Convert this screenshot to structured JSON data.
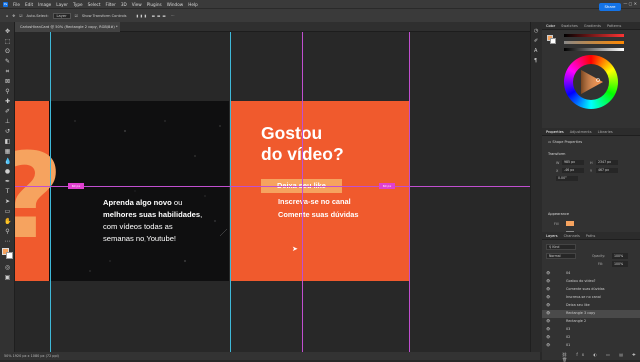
{
  "menubar": {
    "logo": "Ps",
    "items": [
      "File",
      "Edit",
      "Image",
      "Layer",
      "Type",
      "Select",
      "Filter",
      "3D",
      "View",
      "Plugins",
      "Window",
      "Help"
    ]
  },
  "optionsbar": {
    "auto_select": "Auto-Select:",
    "auto_select_value": "Layer",
    "show_transform": "Show Transform Controls",
    "share": "Share"
  },
  "doc_tab": {
    "title": "CarlosHiranCard @ 50% (Rectangle 2 copy, RGB/8#) *"
  },
  "status": {
    "text": "50%      1920 px x 1080 px (72 ppi)"
  },
  "artwork": {
    "left_text_bold1": "Aprenda algo novo",
    "left_text_1": " ou",
    "left_text_bold2": "melhores suas habilidades",
    "left_text_2": ",",
    "left_text_3": "com vídeos todas as",
    "left_text_4": "semanas no Youtube!",
    "title_line1": "Gostou",
    "title_line2": "do vídeo?",
    "btn_like": "Deixa seu like",
    "subscribe": "Inscreva-se no canal",
    "comment": "Comente suas dúvidas",
    "guide_label_left": "60 px",
    "guide_label_right": "60 px",
    "colors": {
      "orange": "#f05a2d",
      "light_orange": "#f6a35f",
      "dark": "#0f0f10"
    }
  },
  "panels": {
    "color_tabs": [
      "Color",
      "Swatches",
      "Gradients",
      "Patterns"
    ],
    "properties_tabs": [
      "Properties",
      "Adjustments",
      "Libraries"
    ],
    "properties_type": "Shape Properties",
    "transform_label": "Transform",
    "w_label": "W",
    "w_value": "985 px",
    "h_label": "H",
    "h_value": "2347 px",
    "x_label": "X",
    "x_value": "-46 px",
    "y_label": "Y",
    "y_value": "467 px",
    "angle_value": "0.00°",
    "appearance_label": "Appearance",
    "fill_label": "Fill",
    "stroke_label": "Stroke",
    "layers_tabs": [
      "Layers",
      "Channels",
      "Paths"
    ],
    "blend_mode": "Normal",
    "opacity_label": "Opacity:",
    "opacity_value": "100%",
    "fill_opacity_label": "Fill:",
    "fill_opacity_value": "100%",
    "layers": [
      {
        "name": "04",
        "selected": false
      },
      {
        "name": "Gostou do vídeo?",
        "selected": false
      },
      {
        "name": "Comente suas dúvidas",
        "selected": false
      },
      {
        "name": "Inscreva-se no canal",
        "selected": false
      },
      {
        "name": "Deixa seu like",
        "selected": false
      },
      {
        "name": "Rectangle 3 copy",
        "selected": true
      },
      {
        "name": "Rectangle 2",
        "selected": false
      },
      {
        "name": "03",
        "selected": false
      },
      {
        "name": "02",
        "selected": false
      },
      {
        "name": "01",
        "selected": false
      }
    ]
  }
}
